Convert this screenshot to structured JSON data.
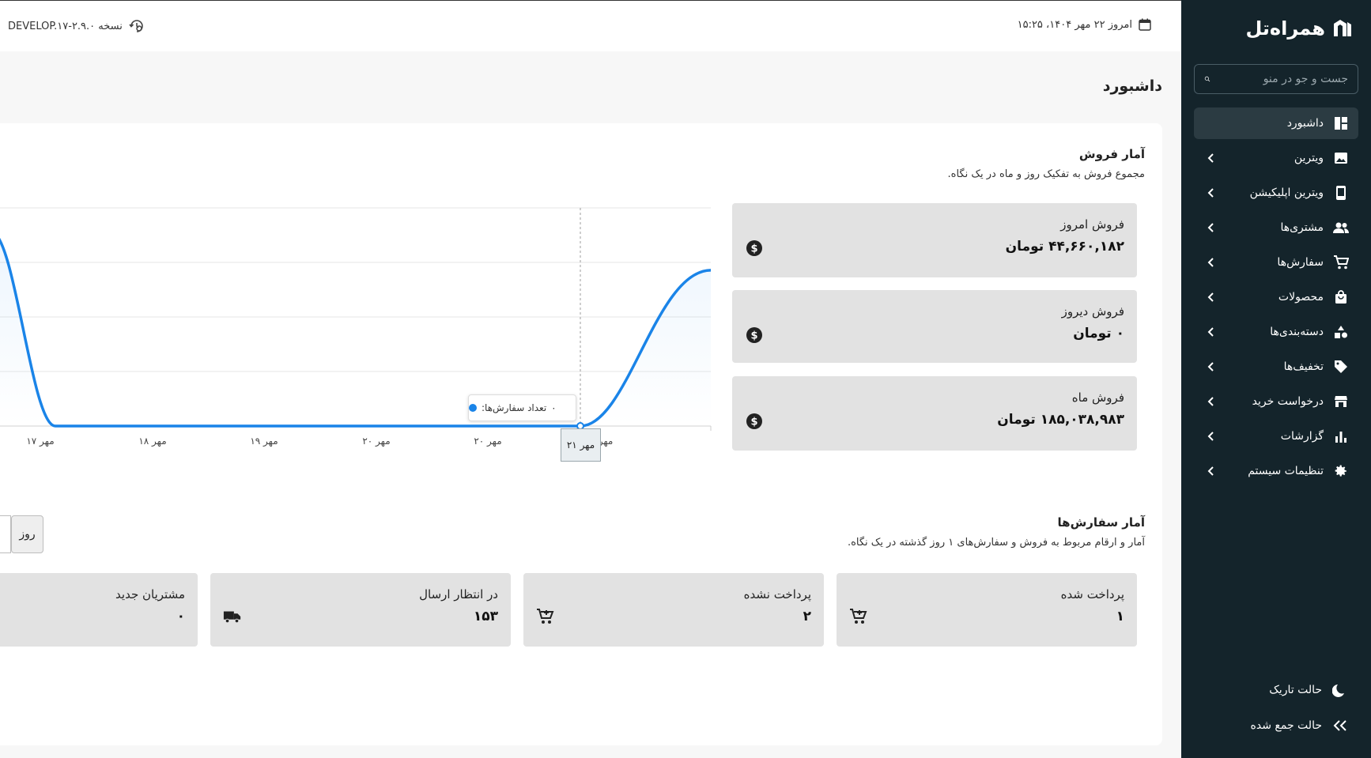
{
  "brand": {
    "name": "همراه‌تل"
  },
  "sidebar": {
    "search_placeholder": "جست و جو در منو",
    "items": [
      {
        "label": "داشبورد",
        "icon": "dashboard-icon",
        "active": true
      },
      {
        "label": "ویترین",
        "icon": "image-icon"
      },
      {
        "label": "ویترین اپلیکیشن",
        "icon": "phone-icon"
      },
      {
        "label": "مشتری‌ها",
        "icon": "users-icon"
      },
      {
        "label": "سفارش‌ها",
        "icon": "cart-icon"
      },
      {
        "label": "محصولات",
        "icon": "bag-icon"
      },
      {
        "label": "دسته‌بندی‌ها",
        "icon": "shapes-icon"
      },
      {
        "label": "تخفیف‌ها",
        "icon": "tag-icon"
      },
      {
        "label": "درخواست خرید",
        "icon": "store-icon"
      },
      {
        "label": "گزارشات",
        "icon": "bar-chart-icon"
      },
      {
        "label": "تنظیمات سیستم",
        "icon": "gear-icon"
      }
    ],
    "dark_mode": "حالت تاریک",
    "collapse": "حالت جمع شده"
  },
  "topbar": {
    "date": "امروز ۲۲ مهر ۱۴۰۴، ۱۵:۲۵",
    "version": "نسخه DEVELOP.۱۷-۲.۹.۰"
  },
  "page": {
    "title": "داشبورد"
  },
  "sales": {
    "title": "آمار فروش",
    "subtitle": "مجموع فروش به تفکیک روز و ماه در یک نگاه.",
    "cards": [
      {
        "title": "فروش امروز",
        "value": "۴۴,۶۶۰,۱۸۲ تومان",
        "icon": "dollar-icon"
      },
      {
        "title": "فروش دیروز",
        "value": "۰ تومان",
        "icon": "dollar-icon"
      },
      {
        "title": "فروش ماه",
        "value": "۱۸۵,۰۳۸,۹۸۳ تومان",
        "icon": "dollar-icon"
      }
    ]
  },
  "tooltip": {
    "label": "تعداد سفارش‌ها:",
    "value": "۰"
  },
  "chart_badge": "مهر ۲۱",
  "chart_data": {
    "type": "area",
    "categories": [
      "مهر ۱۷",
      "مهر ۱۸",
      "مهر ۱۹",
      "مهر ۲۰",
      "مهر ۲۰",
      "مهر ۲۱",
      "مهر"
    ],
    "series": [
      {
        "values": [
          0,
          0,
          0,
          0,
          0,
          0,
          2
        ]
      }
    ],
    "color": "#1a84e8"
  },
  "orders": {
    "title": "آمار سفارش‌ها",
    "subtitle": "آمار و ارقام مربوط به فروش و سفارش‌های ۱ روز گذشته در یک نگاه.",
    "range_label": "روز",
    "cards": [
      {
        "title": "پرداخت شده",
        "value": "۱",
        "icon": "cart-plus-icon"
      },
      {
        "title": "پرداخت نشده",
        "value": "۲",
        "icon": "cart-plus-icon"
      },
      {
        "title": "در انتظار ارسال",
        "value": "۱۵۳",
        "icon": "truck-icon"
      },
      {
        "title": "مشتریان جدید",
        "value": "۰"
      }
    ]
  }
}
